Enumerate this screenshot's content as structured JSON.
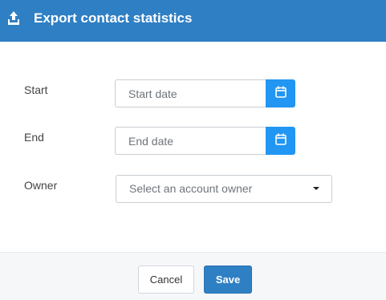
{
  "dialog": {
    "title": "Export contact statistics",
    "header_icon": "upload-icon",
    "accent_color": "#2f7fc4",
    "calendar_button_color": "#2196f3"
  },
  "form": {
    "start": {
      "label": "Start",
      "placeholder": "Start date",
      "value": "",
      "button_icon": "calendar-icon"
    },
    "end": {
      "label": "End",
      "placeholder": "End date",
      "value": "",
      "button_icon": "calendar-icon"
    },
    "owner": {
      "label": "Owner",
      "selected": "Select an account owner",
      "dropdown_icon": "caret-down-icon"
    }
  },
  "footer": {
    "cancel_label": "Cancel",
    "save_label": "Save"
  }
}
